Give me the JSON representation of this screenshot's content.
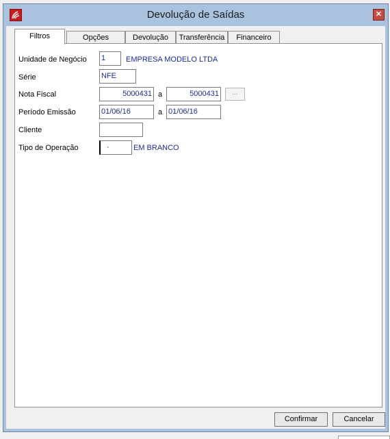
{
  "window": {
    "title": "Devolução de Saídas"
  },
  "tabs": [
    {
      "label": "Filtros",
      "active": true
    },
    {
      "label": "Opções",
      "active": false
    },
    {
      "label": "Devolução",
      "active": false
    },
    {
      "label": "Transferência",
      "active": false
    },
    {
      "label": "Financeiro",
      "active": false
    }
  ],
  "form": {
    "unidade": {
      "label": "Unidade de Negócio",
      "value": "1",
      "description": "EMPRESA MODELO LTDA"
    },
    "serie": {
      "label": "Série",
      "value": "NFE"
    },
    "nota_fiscal": {
      "label": "Nota Fiscal",
      "from": "5000431",
      "sep": "a",
      "to": "5000431",
      "lookup_label": "..."
    },
    "periodo": {
      "label": "Período Emissão",
      "from": "01/06/16",
      "sep": "a",
      "to": "01/06/16"
    },
    "cliente": {
      "label": "Cliente",
      "value": ""
    },
    "tipo_operacao": {
      "label": "Tipo de Operação",
      "value": "·",
      "description": "EM BRANCO"
    }
  },
  "buttons": {
    "confirm": "Confirmar",
    "cancel": "Cancelar"
  },
  "colors": {
    "titlebar": "#a9c3de",
    "value_text": "#1a2a9a",
    "close_button": "#c94a3f"
  }
}
